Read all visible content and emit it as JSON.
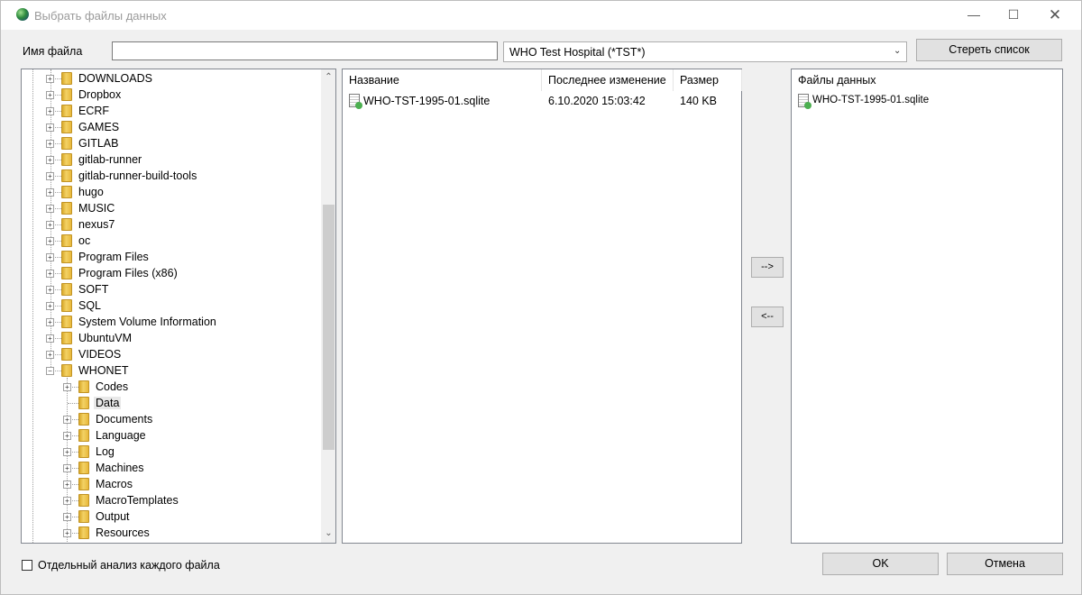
{
  "window": {
    "title": "Выбрать файлы данных",
    "minimize_glyph": "—",
    "maximize_glyph": "☐",
    "close_glyph": "✕"
  },
  "filename": {
    "label": "Имя файла",
    "value": ""
  },
  "database": {
    "selected": "WHO Test Hospital (*TST*)"
  },
  "clear_button": "Стереть список",
  "tree": {
    "top_items": [
      "DOWNLOADS",
      "Dropbox",
      "ECRF",
      "GAMES",
      "GITLAB",
      "gitlab-runner",
      "gitlab-runner-build-tools",
      "hugo",
      "MUSIC",
      "nexus7",
      "oc",
      "Program Files",
      "Program Files (x86)",
      "SOFT",
      "SQL",
      "System Volume Information",
      "UbuntuVM",
      "VIDEOS",
      "WHONET"
    ],
    "expanded": "WHONET",
    "children": [
      "Codes",
      "Data",
      "Documents",
      "Language",
      "Log",
      "Machines",
      "Macros",
      "MacroTemplates",
      "Output",
      "Resources"
    ],
    "selected": "Data"
  },
  "files_panel": {
    "columns": [
      "Название",
      "Последнее изменение",
      "Размер"
    ],
    "rows": [
      {
        "name": "WHO-TST-1995-01.sqlite",
        "modified": "6.10.2020 15:03:42",
        "size": "140 KB"
      }
    ]
  },
  "move_right": "-->",
  "move_left": "<--",
  "datafiles_panel": {
    "header": "Файлы данных",
    "rows": [
      "WHO-TST-1995-01.sqlite"
    ]
  },
  "separate_analysis": {
    "label": "Отдельный анализ каждого файла",
    "checked": false
  },
  "ok_button": "OK",
  "cancel_button": "Отмена",
  "icons": {
    "app": "globe-icon",
    "folder": "folder-icon",
    "file": "database-file-icon"
  }
}
